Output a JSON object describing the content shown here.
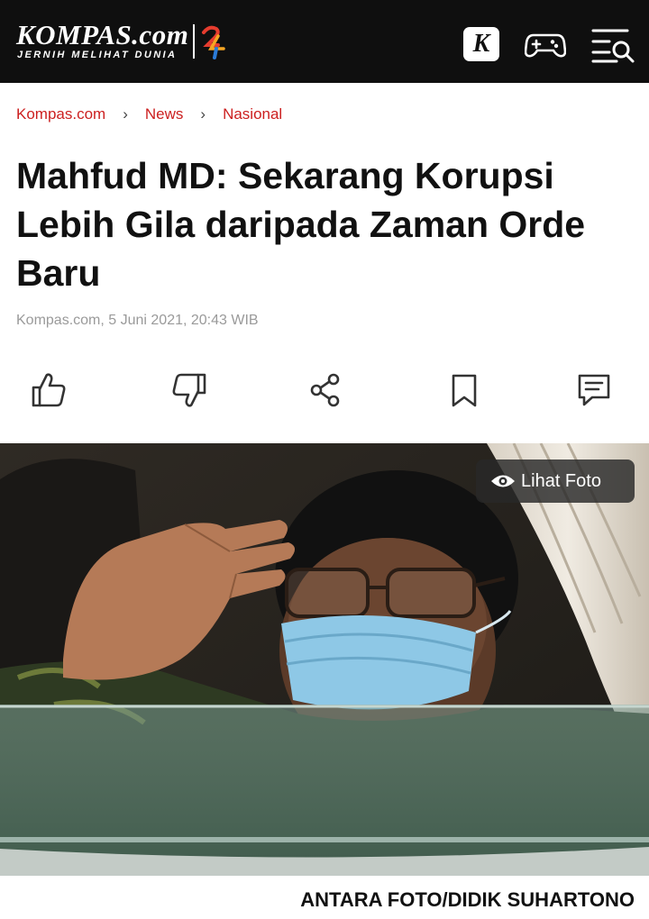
{
  "header": {
    "logo_text": "KOMPAS.com",
    "logo_tagline": "JERNIH MELIHAT DUNIA",
    "k_button_label": "K",
    "background": "#0f0f0f",
    "icons": [
      "kompas-k-icon",
      "gamepad-icon",
      "menu-search-icon"
    ]
  },
  "breadcrumb": {
    "items": [
      "Kompas.com",
      "News",
      "Nasional"
    ],
    "separator": "›",
    "color": "#cc2020"
  },
  "article": {
    "title": "Mahfud MD: Sekarang Korupsi Lebih Gila daripada Zaman Orde Baru",
    "meta": "Kompas.com, 5 Juni 2021, 20:43 WIB"
  },
  "actions": {
    "icons": [
      "thumbs-up-icon",
      "thumbs-down-icon",
      "share-icon",
      "bookmark-icon",
      "comment-icon"
    ]
  },
  "photo": {
    "view_button_label": "Lihat Foto",
    "view_icon": "eye-icon",
    "caption": "ANTARA FOTO/DIDIK SUHARTONO"
  }
}
